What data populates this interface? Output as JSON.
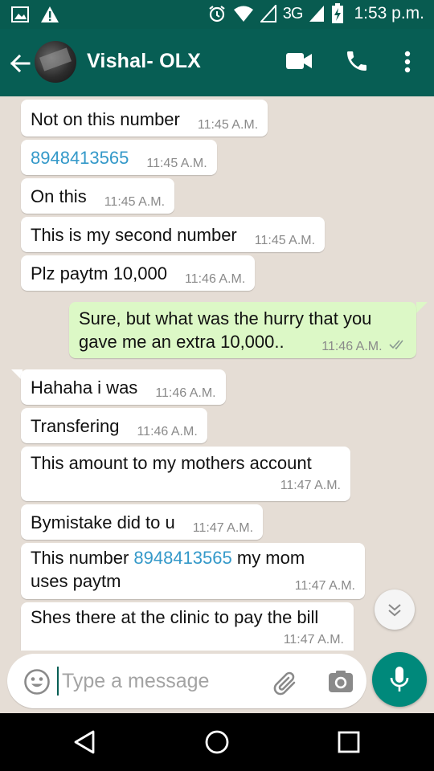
{
  "status_bar": {
    "time": "1:53 p.m.",
    "network": "3G",
    "icons": [
      "image-icon",
      "warning-icon",
      "alarm-icon",
      "wifi-icon",
      "signal-icon",
      "signal-icon",
      "battery-charging-icon"
    ]
  },
  "header": {
    "contact_name": "Vishal- OLX",
    "icons": [
      "back-arrow-icon",
      "avatar",
      "video-call-icon",
      "phone-icon",
      "more-vert-icon"
    ]
  },
  "messages": [
    {
      "dir": "in",
      "text": "Not on this number",
      "time": "11:45 A.M."
    },
    {
      "dir": "in",
      "text": "8948413565",
      "time": "11:45 A.M."
    },
    {
      "dir": "in",
      "text": "On this",
      "time": "11:45 A.M."
    },
    {
      "dir": "in",
      "text": "This is my second number",
      "time": "11:45 A.M."
    },
    {
      "dir": "in",
      "text": "Plz paytm 10,000",
      "time": "11:46 A.M."
    },
    {
      "dir": "out",
      "text_line1": "Sure, but what was the hurry that you",
      "text_line2": "gave me an extra 10,000..",
      "time": "11:46 A.M."
    },
    {
      "dir": "in",
      "text": "Hahaha i was",
      "time": "11:46 A.M."
    },
    {
      "dir": "in",
      "text": "Transfering",
      "time": "11:46 A.M."
    },
    {
      "dir": "in",
      "text": "This amount to my mothers account",
      "time": "11:47 A.M."
    },
    {
      "dir": "in",
      "text": "Bymistake did to u",
      "time": "11:47 A.M."
    },
    {
      "dir": "in",
      "text_before": "This number ",
      "link": "8948413565",
      "text_after": " my mom",
      "text_line2": "uses paytm",
      "time": "11:47 A.M."
    },
    {
      "dir": "in",
      "text": "Shes there at the clinic to pay the bill",
      "time": "11:47 A.M."
    }
  ],
  "input": {
    "placeholder": "Type a message",
    "value": ""
  },
  "colors": {
    "header": "#075e54",
    "status_bar": "#085b50",
    "chat_bg": "#e5ddd5",
    "outgoing_bubble": "#dcf8c6",
    "link": "#3499c9",
    "accent": "#00897b"
  }
}
